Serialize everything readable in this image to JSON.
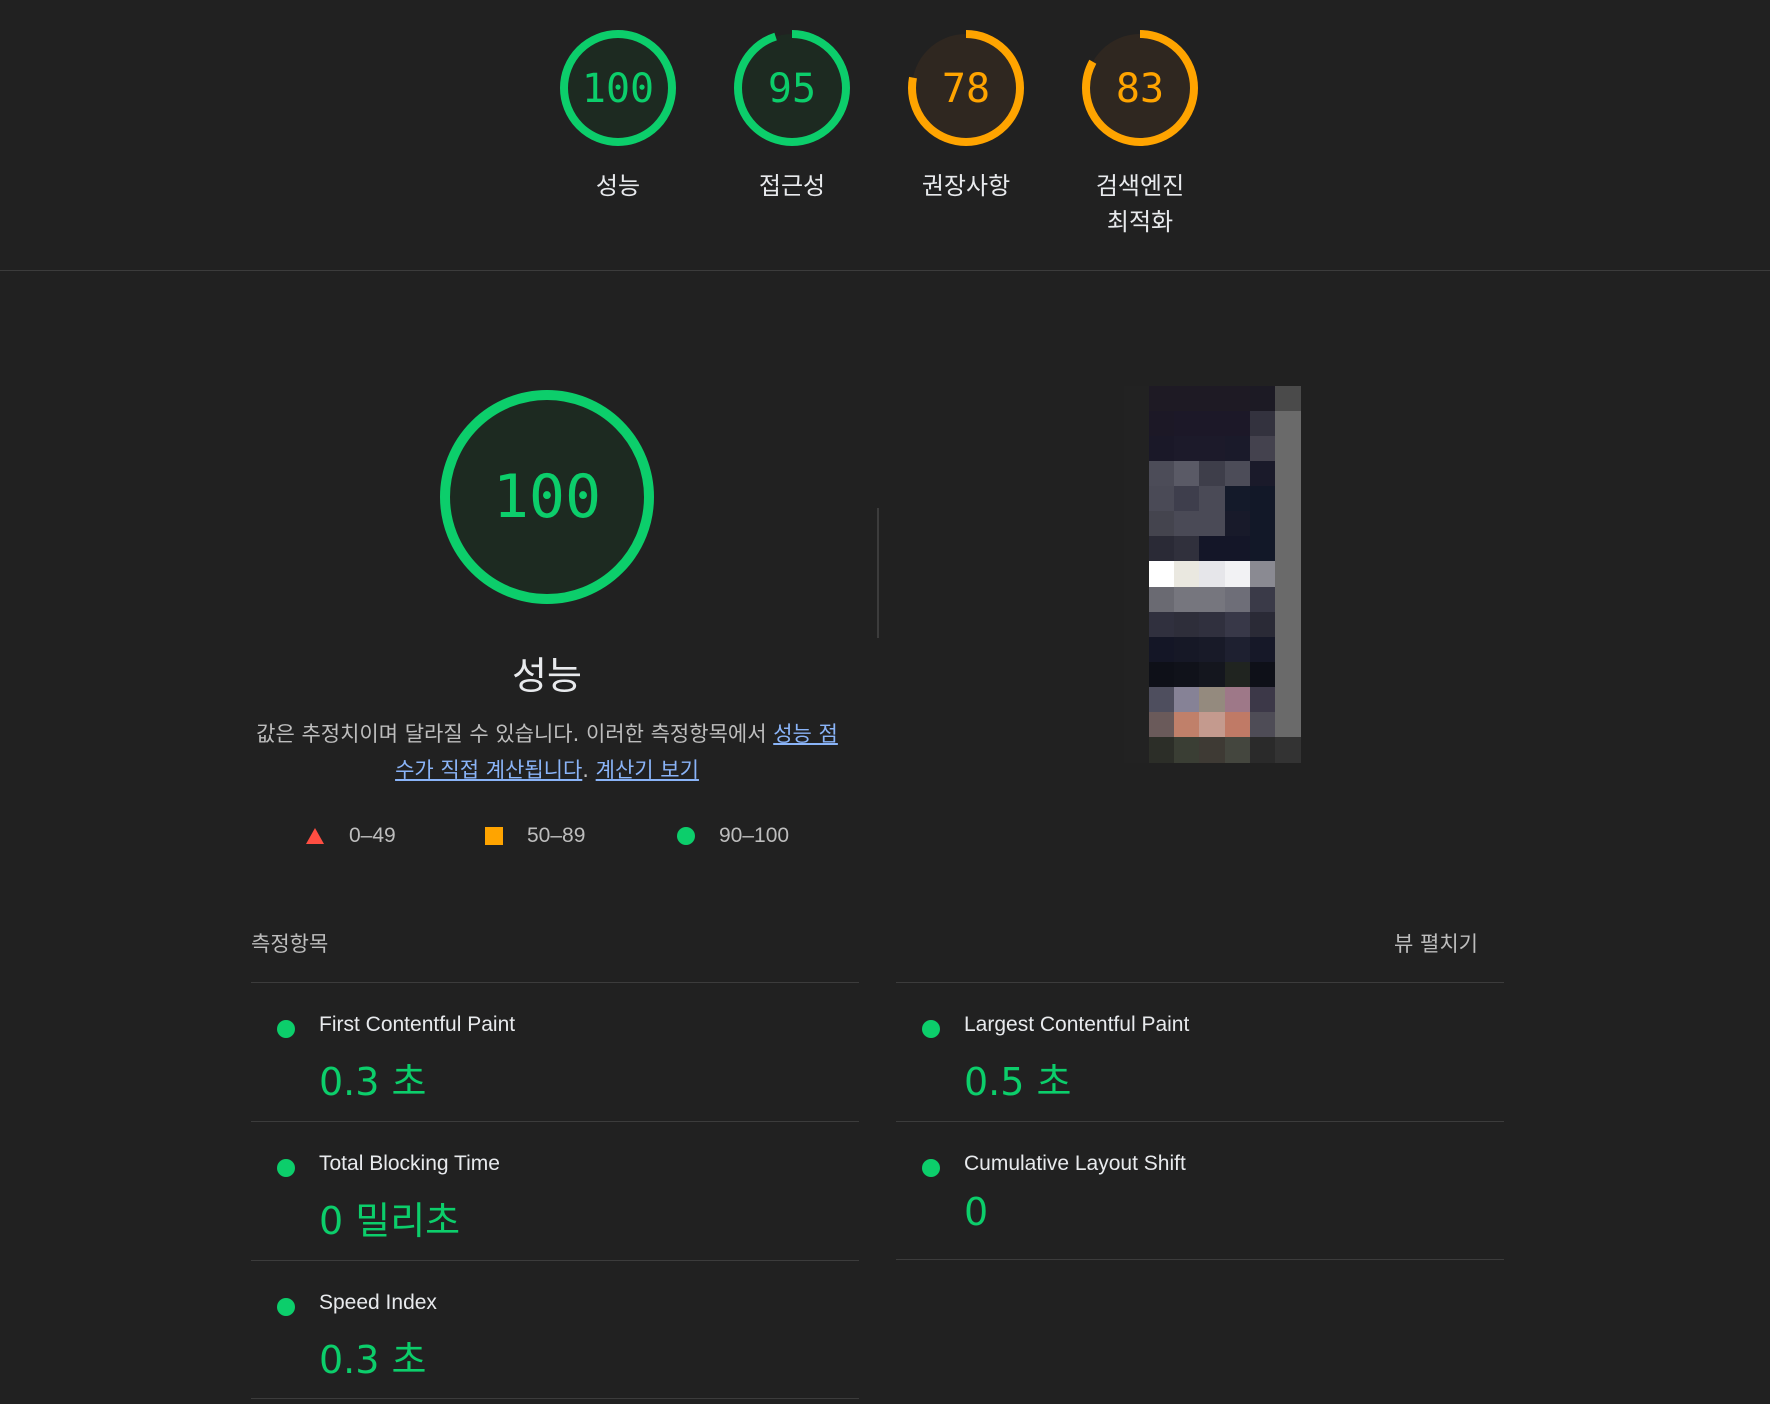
{
  "top_scores": [
    {
      "score": "100",
      "value": 100,
      "label_lines": [
        "성능"
      ],
      "color": "#0cce6b"
    },
    {
      "score": "95",
      "value": 95,
      "label_lines": [
        "접근성"
      ],
      "color": "#0cce6b"
    },
    {
      "score": "78",
      "value": 78,
      "label_lines": [
        "권장사항"
      ],
      "color": "#ffa400"
    },
    {
      "score": "83",
      "value": 83,
      "label_lines": [
        "검색엔진",
        "최적화"
      ],
      "color": "#ffa400"
    }
  ],
  "performance": {
    "score": "100",
    "value": 100,
    "title": "성능",
    "description": "값은 추정치이며 달라질 수 있습니다. 이러한 측정항목에서 ",
    "link1": "성능 점수가 직접 계산됩니다",
    "period": ". ",
    "link2": "계산기 보기"
  },
  "legend": [
    {
      "range": "0–49",
      "shape": "triangle",
      "color": "#ff4e42"
    },
    {
      "range": "50–89",
      "shape": "square",
      "color": "#ffa400"
    },
    {
      "range": "90–100",
      "shape": "circle",
      "color": "#0cce6b"
    }
  ],
  "metrics_section": {
    "title": "측정항목",
    "expand_label": "뷰 펼치기"
  },
  "metrics": [
    {
      "name": "First Contentful Paint",
      "value": "0.3 초"
    },
    {
      "name": "Largest Contentful Paint",
      "value": "0.5 초"
    },
    {
      "name": "Total Blocking Time",
      "value": "0 밀리초"
    },
    {
      "name": "Cumulative Layout Shift",
      "value": "0"
    },
    {
      "name": "Speed Index",
      "value": "0.3 초"
    }
  ],
  "colors": {
    "pass": "#0cce6b",
    "average": "#ffa400",
    "fail": "#ff4e42",
    "background": "#212121",
    "link": "#8ab4f8"
  }
}
